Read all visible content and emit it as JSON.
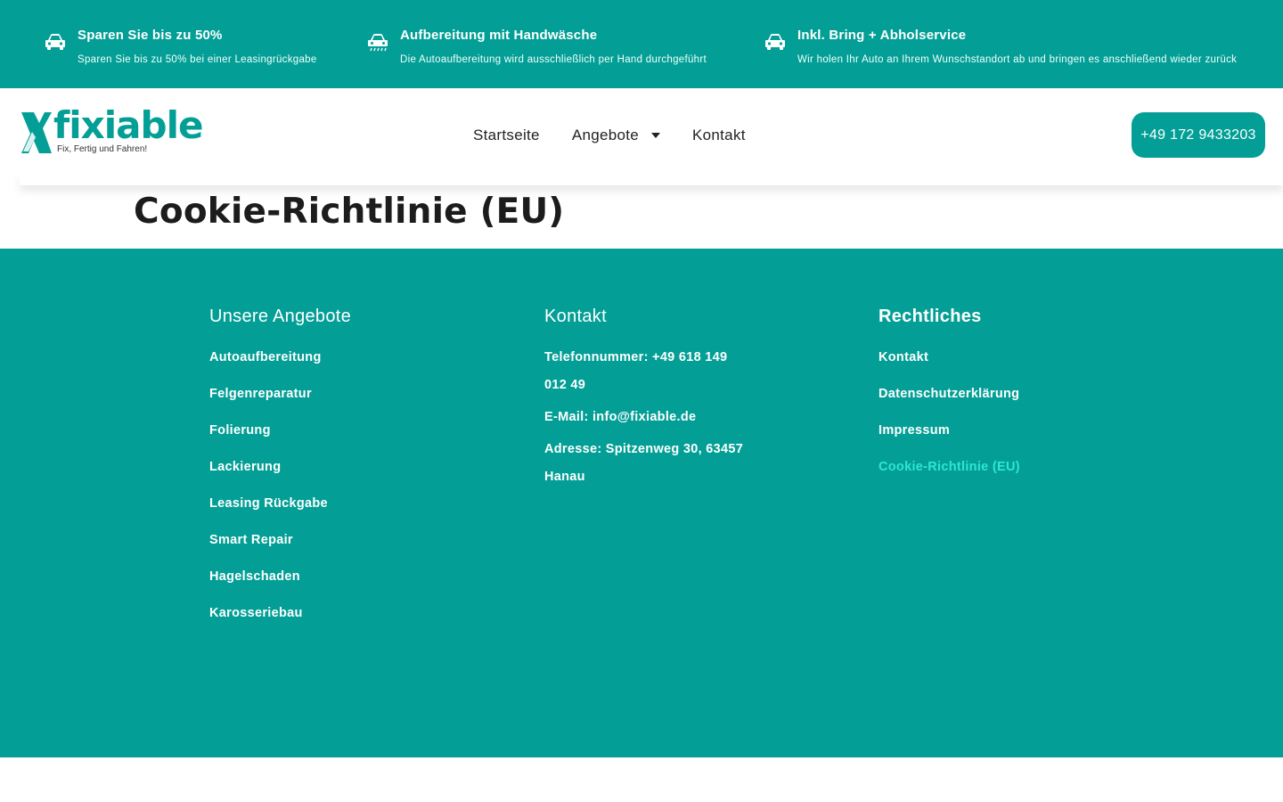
{
  "topbar": {
    "benefits": [
      {
        "icon": "car-icon",
        "title": "Sparen Sie bis zu 50%",
        "desc": "Sparen Sie bis zu 50% bei einer Leasingrückgabe"
      },
      {
        "icon": "car-wash-icon",
        "title": "Aufbereitung mit Handwäsche",
        "desc": "Die Autoaufbereitung wird ausschließlich per Hand durchgeführt"
      },
      {
        "icon": "car-icon",
        "title": "Inkl. Bring + Abholservice",
        "desc": "Wir holen Ihr Auto an Ihrem Wunschstandort ab und bringen es anschließend wieder zurück"
      }
    ]
  },
  "header": {
    "logo": {
      "word": "fixiable",
      "tagline": "Fix, Fertig und Fahren!"
    },
    "nav": [
      {
        "label": "Startseite"
      },
      {
        "label": "Angebote",
        "has_dropdown": true
      },
      {
        "label": "Kontakt"
      }
    ],
    "phone_button": "+49 172 9433203"
  },
  "main": {
    "title": "Cookie-Richtlinie (EU)"
  },
  "footer": {
    "offers": {
      "heading": "Unsere Angebote",
      "links": [
        "Autoaufbereitung",
        "Felgenreparatur",
        "Folierung",
        "Lackierung",
        "Leasing Rückgabe",
        "Smart Repair",
        "Hagelschaden",
        "Karosseriebau"
      ]
    },
    "contact": {
      "heading": "Kontakt",
      "phone": "Telefonnummer: +49 618 149 012 49",
      "email": "E-Mail: info@fixiable.de",
      "address": "Adresse: Spitzenweg 30, 63457 Hanau"
    },
    "legal": {
      "heading": "Rechtliches",
      "links": [
        "Kontakt",
        "Datenschutzerklärung",
        "Impressum",
        "Cookie-Richtlinie (EU)"
      ]
    }
  },
  "colors": {
    "brand": "#039f96",
    "active_link": "#2ee6d3",
    "text_dark": "#1c1c1c",
    "white": "#ffffff"
  }
}
